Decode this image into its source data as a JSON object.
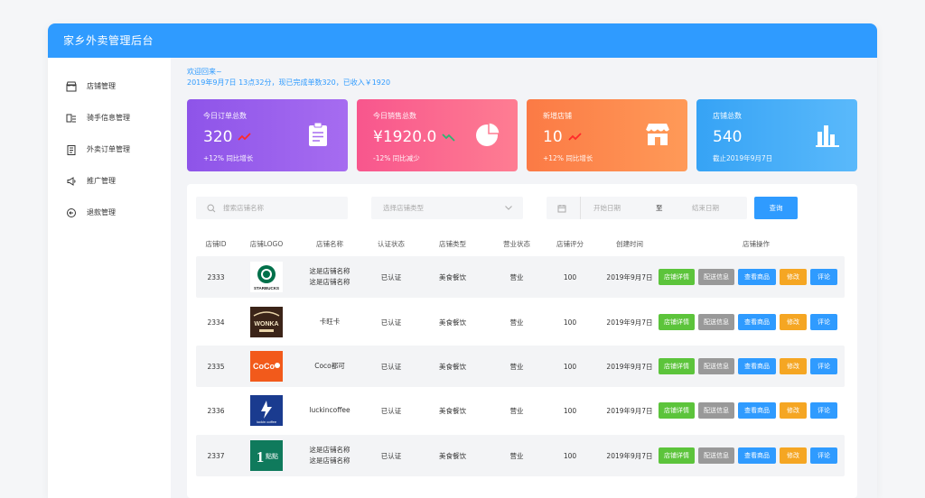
{
  "app": {
    "title": "家乡外卖管理后台"
  },
  "sidebar": {
    "items": [
      {
        "label": "店铺管理",
        "icon": "store-icon"
      },
      {
        "label": "骑手信息管理",
        "icon": "rider-icon"
      },
      {
        "label": "外卖订单管理",
        "icon": "order-icon"
      },
      {
        "label": "推广管理",
        "icon": "megaphone-icon"
      },
      {
        "label": "退款管理",
        "icon": "refund-icon"
      }
    ]
  },
  "welcome": {
    "line1": "欢迎回来~",
    "line2": "2019年9月7日   13点32分，现已完成单数320，已收入￥1920"
  },
  "cards": [
    {
      "title": "今日订单总数",
      "value": "320",
      "sub": "+12%  同比增长",
      "trend": "up",
      "icon": "clipboard-icon",
      "color": "#8e54e9"
    },
    {
      "title": "今日销售总数",
      "value": "¥1920.0",
      "sub": "-12%  同比减少",
      "trend": "down",
      "icon": "pie-chart-icon",
      "color": "#fe5f8f"
    },
    {
      "title": "新增店铺",
      "value": "10",
      "sub": "+12%  同比增长",
      "trend": "up",
      "icon": "shop-icon",
      "color": "#fb8348"
    },
    {
      "title": "店铺总数",
      "value": "540",
      "sub": "截止2019年9月7日",
      "trend": "none",
      "icon": "bar-chart-icon",
      "color": "#3fa8f4"
    }
  ],
  "filters": {
    "search_placeholder": "搜索店铺名称",
    "type_placeholder": "选择店铺类型",
    "start_date": "开始日期",
    "to_label": "至",
    "end_date": "结束日期",
    "query_button": "查询"
  },
  "table": {
    "columns": [
      "店铺ID",
      "店铺LOGO",
      "店铺名称",
      "认证状态",
      "店铺类型",
      "营业状态",
      "店铺评分",
      "创建时间",
      "店铺操作"
    ],
    "actions": [
      "店铺详情",
      "配送信息",
      "查看商品",
      "修改",
      "评论"
    ],
    "rows": [
      {
        "id": "2333",
        "logo": "starbucks",
        "logo_text": "STARBUCKS",
        "name": "这是店铺名称\n这是店铺名称",
        "cert": "已认证",
        "type": "美食餐饮",
        "status": "营业",
        "score": "100",
        "created": "2019年9月7日"
      },
      {
        "id": "2334",
        "logo": "wonka",
        "logo_text": "WONKA",
        "name": "卡旺卡",
        "cert": "已认证",
        "type": "美食餐饮",
        "status": "营业",
        "score": "100",
        "created": "2019年9月7日"
      },
      {
        "id": "2335",
        "logo": "coco",
        "logo_text": "CoCo",
        "name": "Coco都可",
        "cert": "已认证",
        "type": "美食餐饮",
        "status": "营业",
        "score": "100",
        "created": "2019年9月7日"
      },
      {
        "id": "2336",
        "logo": "luckin",
        "logo_text": "luckin coffee",
        "name": "luckincoffee",
        "cert": "已认证",
        "type": "美食餐饮",
        "status": "营业",
        "score": "100",
        "created": "2019年9月7日"
      },
      {
        "id": "2337",
        "logo": "yidiandian",
        "logo_text": "1點點",
        "name": "这是店铺名称\n这是店铺名称",
        "cert": "已认证",
        "type": "美食餐饮",
        "status": "营业",
        "score": "100",
        "created": "2019年9月7日"
      }
    ]
  }
}
